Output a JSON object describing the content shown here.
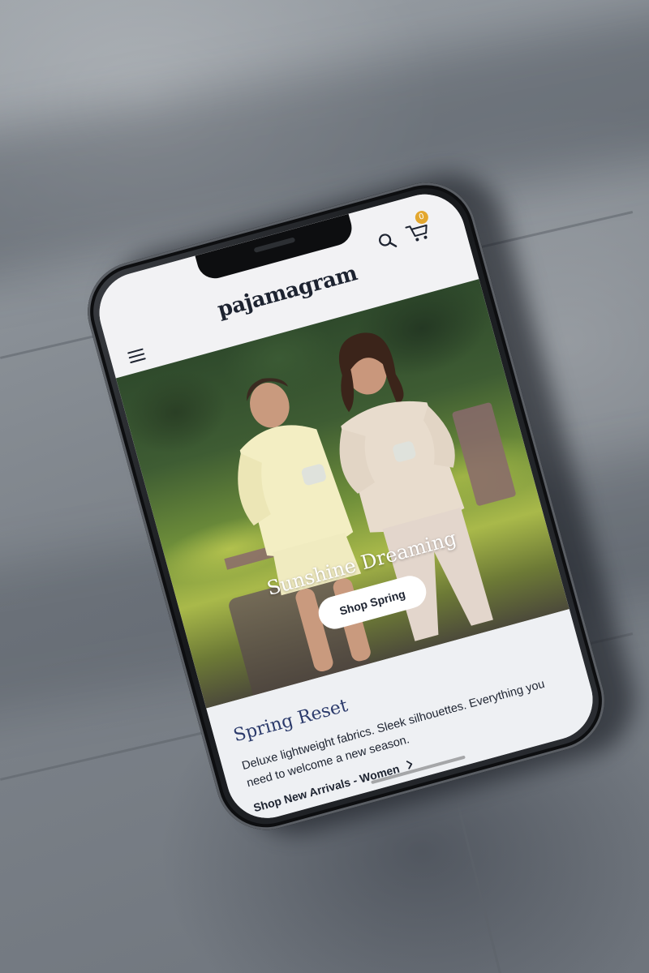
{
  "brand": {
    "logo_text": "pajamagram"
  },
  "header": {
    "menu_icon": "hamburger-menu-icon",
    "search_icon": "search-icon",
    "cart_icon": "shopping-cart-icon",
    "cart_count": "0"
  },
  "hero": {
    "title": "Sunshine Dreaming",
    "cta_label": "Shop Spring"
  },
  "promo": {
    "title": "Spring Reset",
    "body": "Deluxe lightweight fabrics. Sleek silhouettes. Everything you need to welcome a new season.",
    "link_label": "Shop New Arrivals - Women",
    "link_icon": "chevron-right-icon"
  },
  "colors": {
    "brand_navy": "#1d2330",
    "accent_blue": "#2b3a6b",
    "badge_gold": "#e3a72f",
    "page_background": "#eef0f3"
  }
}
